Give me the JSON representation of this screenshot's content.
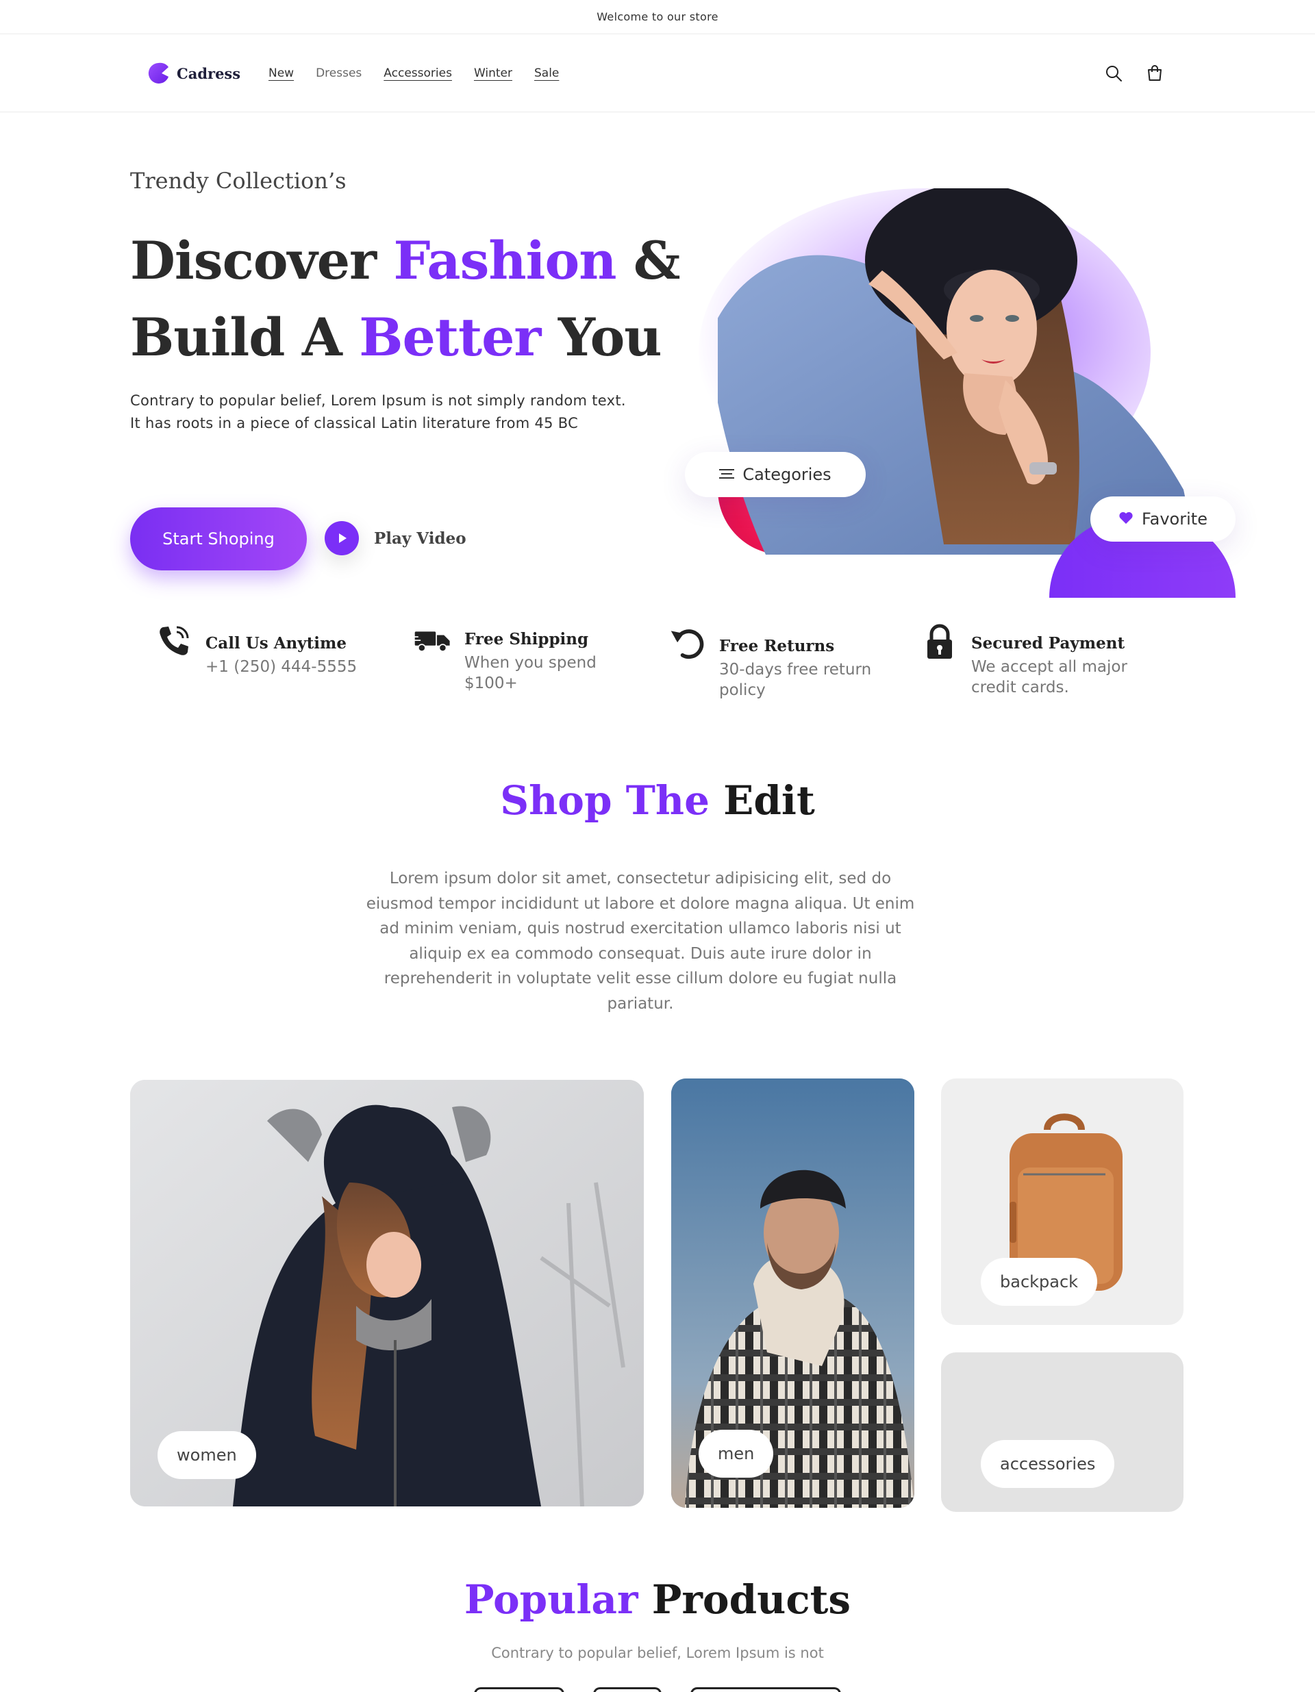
{
  "announcement": "Welcome to our store",
  "brand": {
    "name": "Cadress",
    "accent_color": "#7b2ff7"
  },
  "nav": {
    "items": [
      {
        "label": "New"
      },
      {
        "label": "Dresses"
      },
      {
        "label": "Accessories"
      },
      {
        "label": "Winter"
      },
      {
        "label": "Sale"
      }
    ]
  },
  "header_icons": [
    "search-icon",
    "cart-icon"
  ],
  "hero": {
    "eyebrow": "Trendy Collection’s",
    "headline": {
      "line1_a": "Discover ",
      "line1_b": "Fashion",
      "line1_c": " &",
      "line2_a": "Build A ",
      "line2_b": "Better",
      "line2_c": " You"
    },
    "description": "Contrary to popular belief, Lorem Ipsum is not simply random text. It has roots in a piece of classical Latin literature from 45 BC",
    "primary_button": "Start Shoping",
    "play_label": "Play Video",
    "categories_pill": "Categories",
    "favorite_pill": "Favorite"
  },
  "features": [
    {
      "icon": "phone-icon",
      "title": "Call Us Anytime",
      "text": "+1 (250) 444-5555"
    },
    {
      "icon": "truck-icon",
      "title": "Free Shipping",
      "text": "When you spend $100+"
    },
    {
      "icon": "return-icon",
      "title": "Free Returns",
      "text": "30-days free return policy"
    },
    {
      "icon": "lock-icon",
      "title": "Secured Payment",
      "text": "We accept all major credit cards."
    }
  ],
  "shop_edit": {
    "title_a": "Shop The",
    "title_b": " Edit",
    "description": "Lorem ipsum dolor sit amet, consectetur adipisicing elit, sed do eiusmod tempor incididunt ut labore et dolore magna aliqua. Ut enim ad minim veniam, quis nostrud exercitation ullamco laboris nisi ut aliquip ex ea commodo consequat. Duis aute irure dolor in reprehenderit in voluptate velit esse cillum dolore eu fugiat nulla pariatur.",
    "tiles": [
      {
        "label": "women"
      },
      {
        "label": "men"
      },
      {
        "label": "backpack"
      },
      {
        "label": "accessories"
      }
    ]
  },
  "popular": {
    "title_a": "Popular",
    "title_b": " Products",
    "subtitle": "Contrary to popular belief, Lorem Ipsum is not"
  }
}
